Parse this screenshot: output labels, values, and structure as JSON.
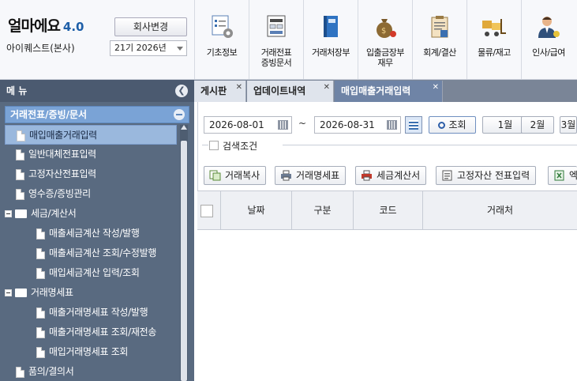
{
  "header": {
    "brand": "얼마에요",
    "version": "4.0",
    "company_name": "아이퀘스트(본사)",
    "change_company_label": "회사변경",
    "period_value": "21기 2026년"
  },
  "top_menu": [
    {
      "label": "기초정보",
      "icon": "settings-form-icon"
    },
    {
      "label": "거래전표\n증빙문서",
      "icon": "voucher-icon"
    },
    {
      "label": "거래처장부",
      "icon": "ledger-book-icon"
    },
    {
      "label": "입출금장부\n재무",
      "icon": "money-bag-icon"
    },
    {
      "label": "회계/결산",
      "icon": "clipboard-icon"
    },
    {
      "label": "물류/재고",
      "icon": "forklift-icon"
    },
    {
      "label": "인사/급여",
      "icon": "person-icon"
    }
  ],
  "sidebar": {
    "title": "메 뉴",
    "group": "거래전표/증빙/문서",
    "items": [
      {
        "label": "매입매출거래입력",
        "type": "doc",
        "level": 1,
        "selected": true
      },
      {
        "label": "일반대체전표입력",
        "type": "doc",
        "level": 1
      },
      {
        "label": "고정자산전표입력",
        "type": "doc",
        "level": 1
      },
      {
        "label": "영수증/증빙관리",
        "type": "doc",
        "level": 1
      },
      {
        "label": "세금/계산서",
        "type": "folder",
        "level": 0
      },
      {
        "label": "매출세금계산 작성/발행",
        "type": "doc",
        "level": 2
      },
      {
        "label": "매출세금계산 조회/수정발행",
        "type": "doc",
        "level": 2
      },
      {
        "label": "매입세금계산 입력/조회",
        "type": "doc",
        "level": 2
      },
      {
        "label": "거래명세표",
        "type": "folder",
        "level": 0
      },
      {
        "label": "매출거래명세표 작성/발행",
        "type": "doc",
        "level": 2
      },
      {
        "label": "매출거래명세표 조회/재전송",
        "type": "doc",
        "level": 2
      },
      {
        "label": "매입거래명세표 조회",
        "type": "doc",
        "level": 2
      },
      {
        "label": "품의/결의서",
        "type": "doc",
        "level": 1
      }
    ]
  },
  "tabs": [
    {
      "label": "게시판"
    },
    {
      "label": "업데이트내역"
    },
    {
      "label": "매입매출거래입력",
      "active": true
    }
  ],
  "search": {
    "date_from": "2026-08-01",
    "date_to": "2026-08-31",
    "tilde": "~",
    "search_button": "조회",
    "month_buttons": [
      "1월",
      "2월",
      "3월"
    ],
    "condition_label": "검색조건"
  },
  "actions": [
    {
      "label": "거래복사",
      "icon": "copy-icon"
    },
    {
      "label": "거래명세표",
      "icon": "printer-icon"
    },
    {
      "label": "세금계산서",
      "icon": "printer-icon"
    },
    {
      "label": "고정자산 전표입력",
      "icon": "asset-icon"
    },
    {
      "label": "엑",
      "icon": "excel-icon"
    }
  ],
  "grid": {
    "columns": [
      "날짜",
      "구분",
      "코드",
      "거래처"
    ]
  }
}
